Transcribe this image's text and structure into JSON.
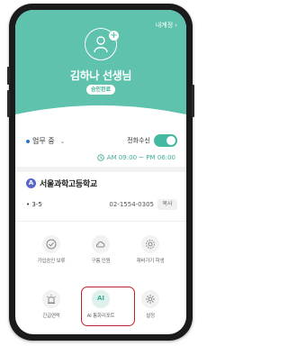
{
  "header": {
    "top_link": "내계정",
    "user_name": "김하나 선생님",
    "status_badge": "승인완료",
    "bg_color": "#5ec2ad"
  },
  "work": {
    "status": "업무 중",
    "call_label": "전화수신",
    "call_toggle_on": true,
    "hours": "AM 09:00 ~ PM 06:00"
  },
  "school": {
    "icon_letter": "A",
    "name": "서울과학고등학교",
    "class_name": "3-5",
    "phone": "02-1554-0305",
    "copy_label": "복사"
  },
  "menu": [
    {
      "label": "가입승인 보류",
      "icon": "check-circle-icon"
    },
    {
      "label": "구름 인원",
      "icon": "cloud-icon"
    },
    {
      "label": "재바가기 학생",
      "icon": "gear-icon"
    },
    {
      "label": "긴급연락",
      "icon": "alert-icon"
    },
    {
      "label": "AI 통화리포트",
      "icon": "ai-icon",
      "icon_text": "AI"
    },
    {
      "label": "설정",
      "icon": "settings-icon"
    }
  ],
  "highlight_color": "#b7262a"
}
